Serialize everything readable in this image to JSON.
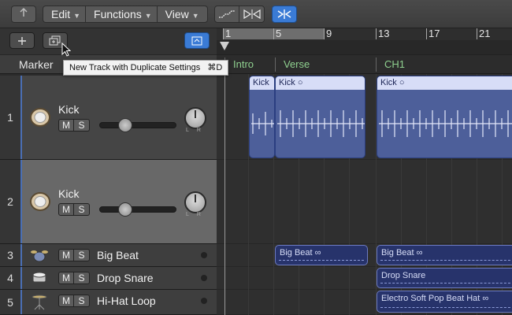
{
  "toolbar": {
    "back_icon": "back-arrow-icon",
    "menus": [
      {
        "label": "Edit"
      },
      {
        "label": "Functions"
      },
      {
        "label": "View"
      }
    ],
    "tools": [
      "flex-tool-icon",
      "waveform-zoom-icon"
    ],
    "catch_icon": "catch-playhead-icon"
  },
  "header": {
    "new_track_icon": "plus-icon",
    "duplicate_track_icon": "duplicate-track-icon",
    "global_tracks_icon": "global-tracks-icon"
  },
  "tooltip": {
    "text": "New Track with Duplicate Settings",
    "shortcut": "⌘D"
  },
  "ruler": {
    "bars": [
      "1",
      "5",
      "9",
      "13",
      "17",
      "21"
    ]
  },
  "marker": {
    "label": "Marker",
    "items": [
      "Intro",
      "Verse",
      "CH1"
    ]
  },
  "tracks": [
    {
      "number": "1",
      "name": "Kick",
      "mute": "M",
      "solo": "S",
      "pan_l": "L",
      "pan_r": "R",
      "selected": false
    },
    {
      "number": "2",
      "name": "Kick",
      "mute": "M",
      "solo": "S",
      "pan_l": "L",
      "pan_r": "R",
      "selected": true
    },
    {
      "number": "3",
      "name": "Big Beat",
      "mute": "M",
      "solo": "S"
    },
    {
      "number": "4",
      "name": "Drop Snare",
      "mute": "M",
      "solo": "S"
    },
    {
      "number": "5",
      "name": "Hi-Hat Loop",
      "mute": "M",
      "solo": "S"
    }
  ],
  "regions": {
    "kick_a": "Kick",
    "kick_b": "Kick",
    "kick_c": "Kick",
    "big_beat_a": "Big Beat",
    "big_beat_b": "Big Beat",
    "drop_snare": "Drop Snare",
    "hihat": "Electro Soft Pop Beat Hat"
  },
  "colors": {
    "accent": "#3a7bd5",
    "region_kick": "#4d5f9a",
    "region_beat": "#27336b",
    "marker_text": "#8fd08f"
  }
}
